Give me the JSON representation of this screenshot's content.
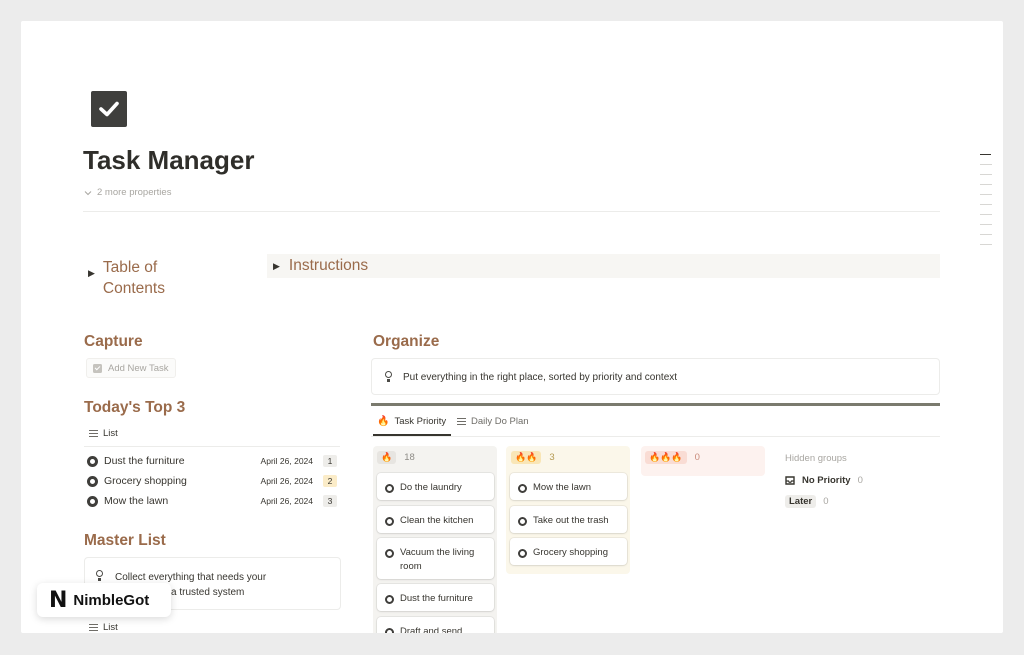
{
  "page": {
    "title": "Task Manager",
    "more_properties": "2 more properties",
    "toc_label": "Table of Contents",
    "instructions_label": "Instructions"
  },
  "capture": {
    "heading": "Capture",
    "add_task": "Add New Task"
  },
  "top3": {
    "heading": "Today's Top 3",
    "view_label": "List",
    "items": [
      {
        "name": "Dust the furniture",
        "date": "April 26, 2024",
        "num": "1"
      },
      {
        "name": "Grocery shopping",
        "date": "April 26, 2024",
        "num": "2"
      },
      {
        "name": "Mow the lawn",
        "date": "April 26, 2024",
        "num": "3"
      }
    ]
  },
  "master": {
    "heading": "Master List",
    "callout_line1": "Collect everything that needs your",
    "callout_line2": "a trusted system",
    "view_label": "List"
  },
  "organize": {
    "heading": "Organize",
    "callout": "Put everything in the right place, sorted by priority and context",
    "tabs": [
      "Task Priority",
      "Daily Do Plan"
    ],
    "columns": [
      {
        "label": "🔥",
        "count": "18",
        "cards": [
          "Do the laundry",
          "Clean the kitchen",
          "Vacuum the living room",
          "Dust the furniture",
          "Draft and send"
        ]
      },
      {
        "label": "🔥🔥",
        "count": "3",
        "cards": [
          "Mow the lawn",
          "Take out the trash",
          "Grocery shopping"
        ]
      },
      {
        "label": "🔥🔥🔥",
        "count": "0",
        "cards": []
      }
    ],
    "hidden_groups": {
      "label": "Hidden groups",
      "items": [
        {
          "name": "No Priority",
          "count": "0"
        },
        {
          "name": "Later",
          "count": "0"
        }
      ]
    }
  },
  "watermark": {
    "logo": "N",
    "text": "NimbleGot"
  },
  "colors": {
    "accent_brown": "#9a6b4b",
    "col1_bg": "#f4f3f0",
    "col2_bg": "#fbf7ea",
    "col3_bg": "#fdf2ef"
  }
}
